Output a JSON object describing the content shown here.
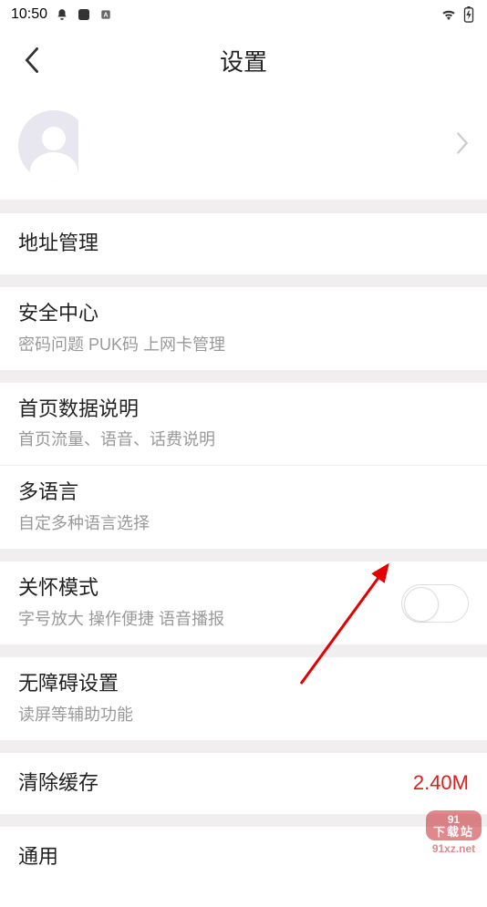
{
  "status": {
    "time": "10:50"
  },
  "header": {
    "title": "设置"
  },
  "items": {
    "address": {
      "title": "地址管理"
    },
    "security": {
      "title": "安全中心",
      "subtitle": "密码问题 PUK码 上网卡管理"
    },
    "homedata": {
      "title": "首页数据说明",
      "subtitle": "首页流量、语音、话费说明"
    },
    "language": {
      "title": "多语言",
      "subtitle": "自定多种语言选择"
    },
    "care": {
      "title": "关怀模式",
      "subtitle": "字号放大 操作便捷 语音播报"
    },
    "accessibility": {
      "title": "无障碍设置",
      "subtitle": "读屏等辅助功能"
    },
    "cache": {
      "title": "清除缓存",
      "value": "2.40M"
    },
    "general": {
      "title": "通用"
    }
  },
  "watermark": {
    "badge_top": "91",
    "badge_cn": "下载站",
    "url": "91xz.net"
  }
}
